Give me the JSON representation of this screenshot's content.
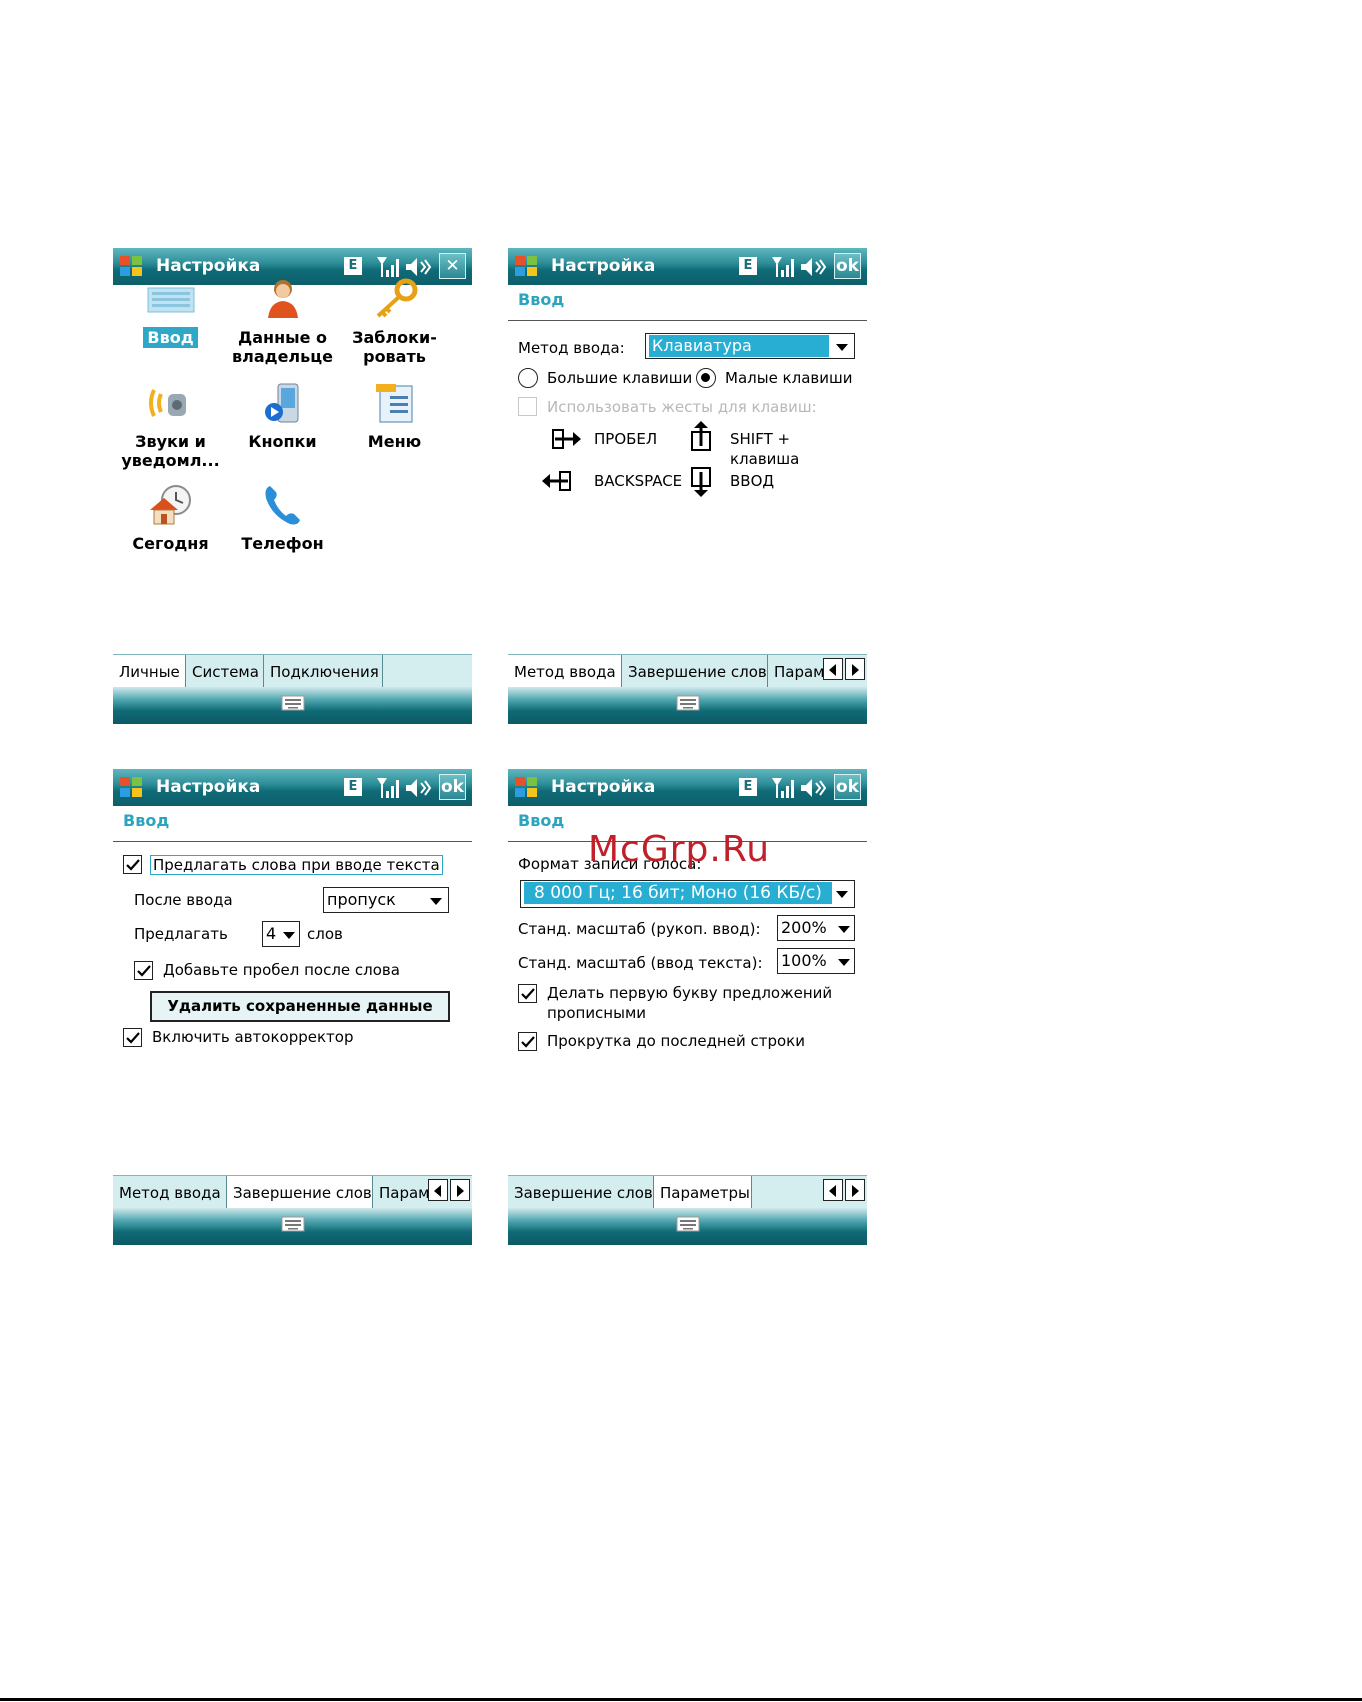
{
  "common": {
    "title": "Настройка",
    "status_e": "E"
  },
  "screen1": {
    "close_label": "✕",
    "tiles": [
      {
        "label": "Ввод"
      },
      {
        "label": "Данные о владельце"
      },
      {
        "label": "Заблоки-ровать"
      },
      {
        "label": "Звуки и уведомл..."
      },
      {
        "label": "Кнопки"
      },
      {
        "label": "Меню"
      },
      {
        "label": "Сегодня"
      },
      {
        "label": "Телефон"
      }
    ],
    "tile_lines": {
      "t0": "Ввод",
      "t1a": "Данные о",
      "t1b": "владельце",
      "t2a": "Заблоки-",
      "t2b": "ровать",
      "t3a": "Звуки и",
      "t3b": "уведомл...",
      "t4": "Кнопки",
      "t5": "Меню",
      "t6": "Сегодня",
      "t7": "Телефон"
    },
    "tabs": [
      "Личные",
      "Система",
      "Подключения"
    ]
  },
  "screen2": {
    "ok_label": "ok",
    "section": "Ввод",
    "method_label": "Метод ввода:",
    "method_value": "Клавиатура",
    "radio_large": "Большие клавиши",
    "radio_small": "Малые клавиши",
    "gestures_label": "Использовать жесты для клавиш:",
    "g_space": "ПРОБЕЛ",
    "g_shift_a": "SHIFT +",
    "g_shift_b": "клавиша",
    "g_backspace": "BACKSPACE",
    "g_enter": "ВВОД",
    "tabs": [
      "Метод ввода",
      "Завершение слов",
      "Парам"
    ]
  },
  "screen3": {
    "ok_label": "ok",
    "section": "Ввод",
    "suggest_words": "Предлагать слова при вводе текста",
    "after_input_label": "После ввода",
    "after_input_value": "пропуск",
    "suggest_label": "Предлагать",
    "suggest_count": "4",
    "words_label": "слов",
    "add_space": "Добавьте пробел после слова",
    "delete_button": "Удалить сохраненные данные",
    "autocorrect": "Включить автокорректор",
    "tabs": [
      "Метод ввода",
      "Завершение слов",
      "Парам"
    ]
  },
  "screen4": {
    "ok_label": "ok",
    "section": "Ввод",
    "voice_format_label": "Формат записи голоса:",
    "voice_format_value": "8 000 Гц; 16 бит; Моно (16 КБ/с)",
    "zoom_handwriting_label": "Станд. масштаб (рукоп. ввод):",
    "zoom_handwriting_value": "200%",
    "zoom_text_label": "Станд. масштаб (ввод текста):",
    "zoom_text_value": "100%",
    "capitalize_a": "Делать первую букву предложений",
    "capitalize_b": "прописными",
    "scroll_last": "Прокрутка до последней строки",
    "tabs": [
      "Завершение слов",
      "Параметры"
    ]
  },
  "watermark": "McGrp.Ru"
}
